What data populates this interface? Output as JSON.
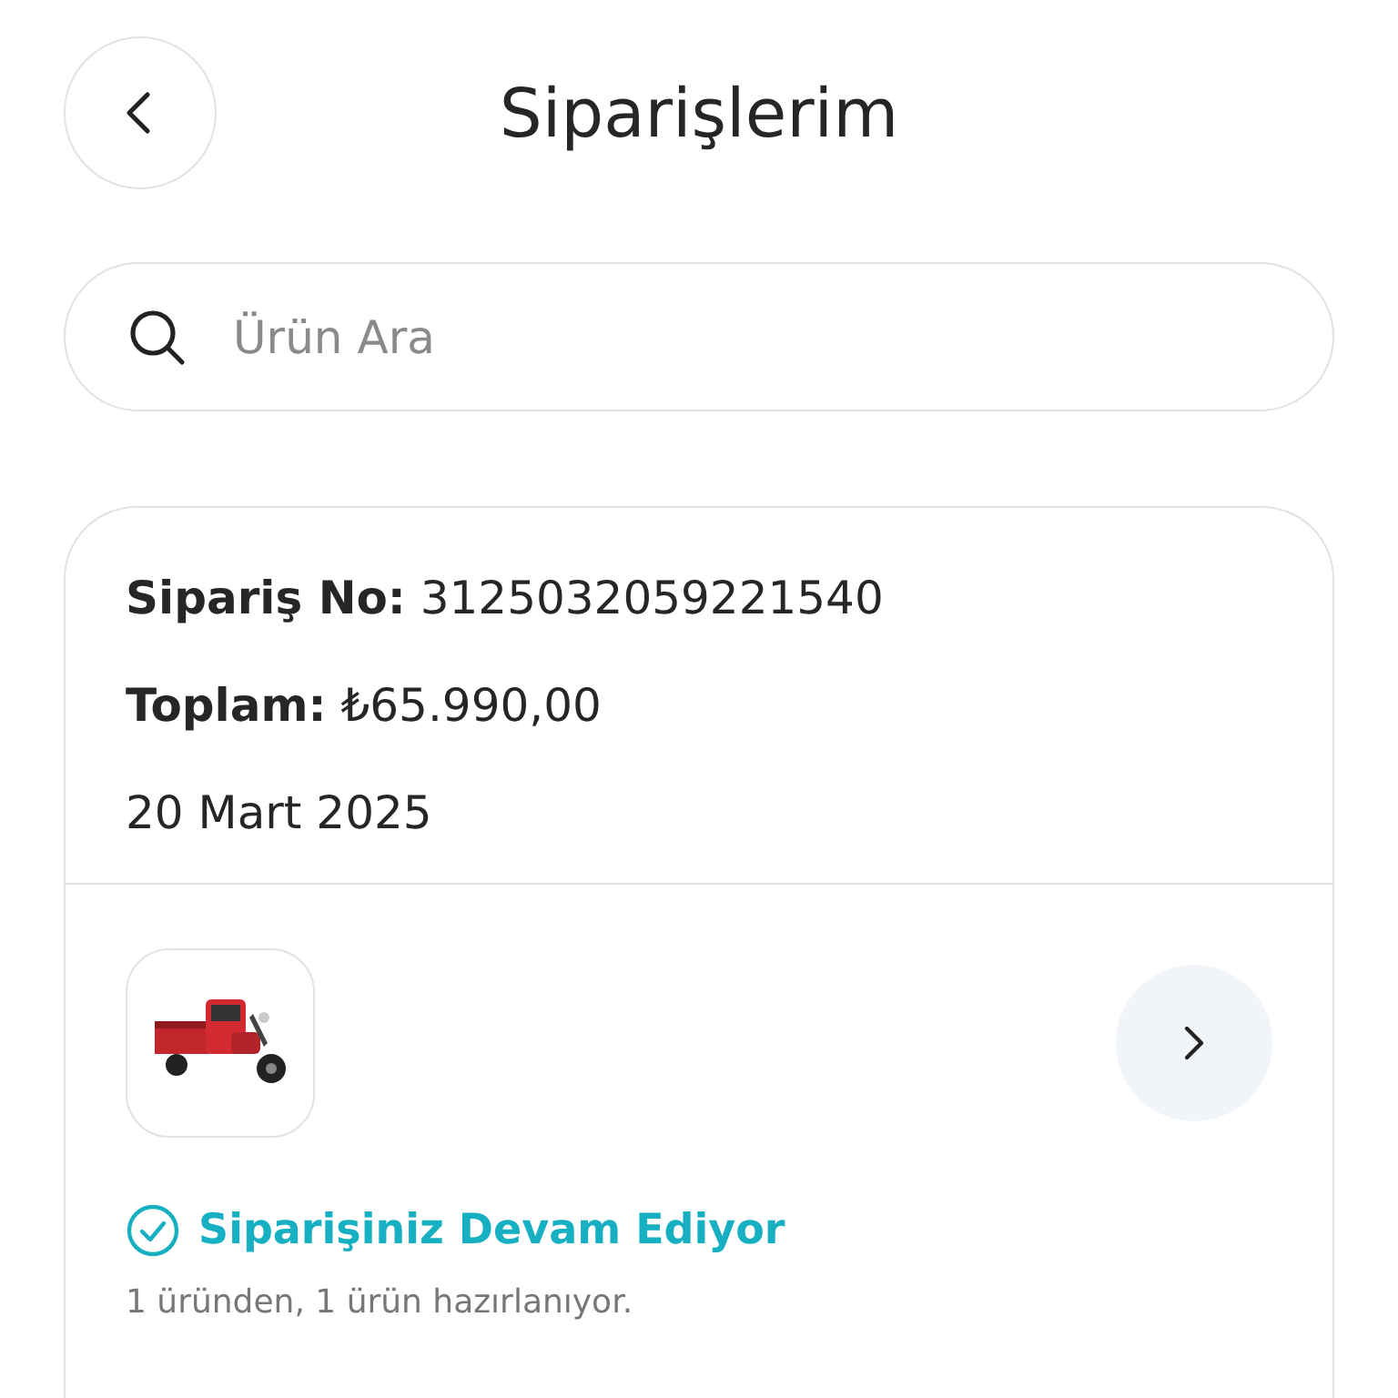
{
  "header": {
    "title": "Siparişlerim"
  },
  "search": {
    "placeholder": "Ürün Ara"
  },
  "order": {
    "number_line": "**Sipariş No:** 3125032059221540",
    "total_line": "**Toplam:** ₺65.990,00",
    "date": "20 Mart 2025",
    "status": "Siparişiniz Devam Ediyor",
    "note": "1 üründen, 1 ürün hazırlanıyor."
  }
}
